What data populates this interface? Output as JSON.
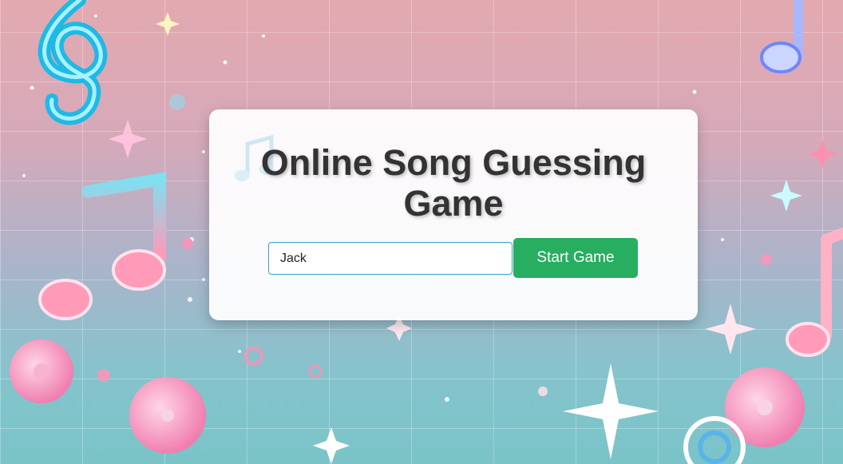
{
  "page": {
    "title": "Online Song Guessing Game"
  },
  "form": {
    "name_value": "Jack",
    "start_label": "Start Game"
  },
  "colors": {
    "accent_button": "#27ae60",
    "title_text": "#333333",
    "input_border": "#3b9fd1"
  },
  "background": {
    "decorations": [
      "treble-clef-icon",
      "music-note-icon",
      "sparkle-icon",
      "disc-icon"
    ]
  }
}
